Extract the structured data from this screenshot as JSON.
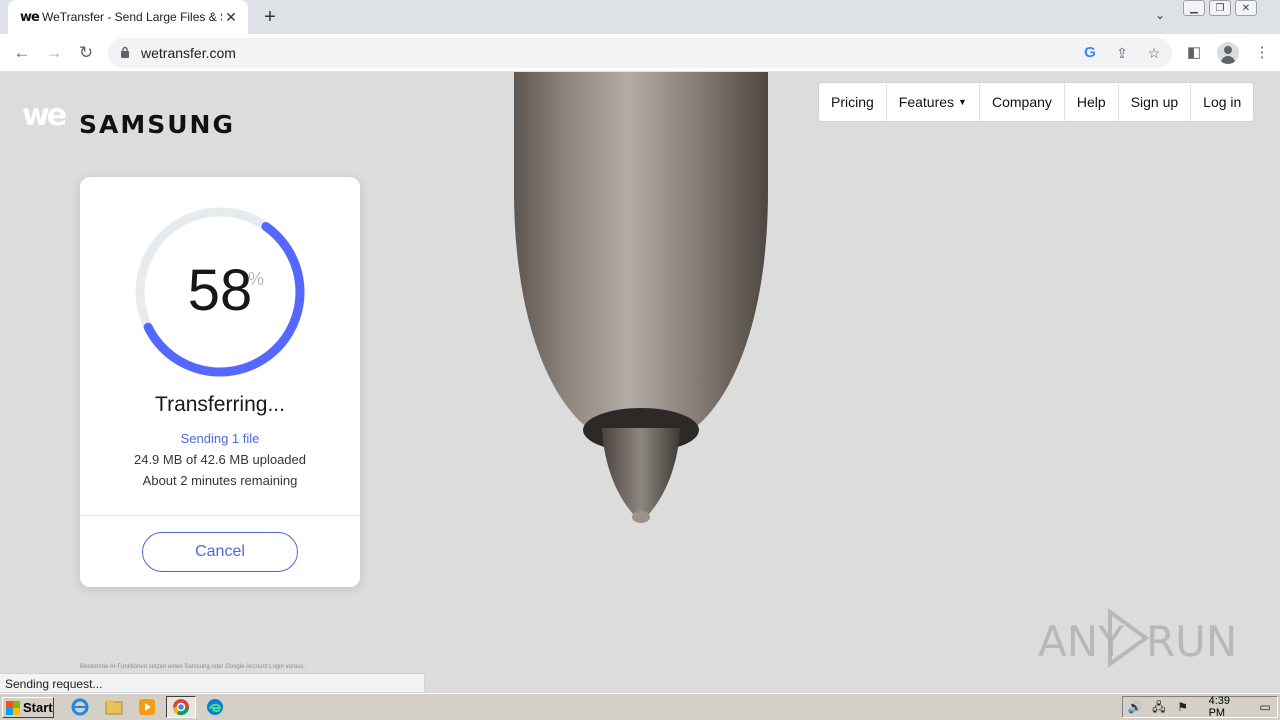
{
  "browser": {
    "tab_title": "WeTransfer - Send Large Files & Sha",
    "tab_favicon": "we",
    "url": "wetransfer.com"
  },
  "header": {
    "logo_we": "we",
    "logo_brand": "SAMSUNG",
    "nav": [
      {
        "label": "Pricing"
      },
      {
        "label": "Features"
      },
      {
        "label": "Company"
      },
      {
        "label": "Help"
      },
      {
        "label": "Sign up"
      },
      {
        "label": "Log in"
      }
    ]
  },
  "transfer": {
    "percent": "58",
    "percent_sign": "%",
    "progress_fraction": 0.58,
    "title": "Transferring...",
    "sending": "Sending 1 file",
    "uploaded": "24.9 MB of 42.6 MB uploaded",
    "remaining": "About 2 minutes remaining",
    "cancel_label": "Cancel",
    "ring_color": "#5468ff",
    "track_color": "#e8ebee"
  },
  "footer": {
    "disclaimer": "Bestimmte AI-Funktionen setzen einen Samsung oder Google Account Login voraus.",
    "status": "Sending request..."
  },
  "watermark": {
    "left": "ANY",
    "right": "RUN"
  },
  "taskbar": {
    "start_label": "Start",
    "clock": "4:39 PM"
  }
}
